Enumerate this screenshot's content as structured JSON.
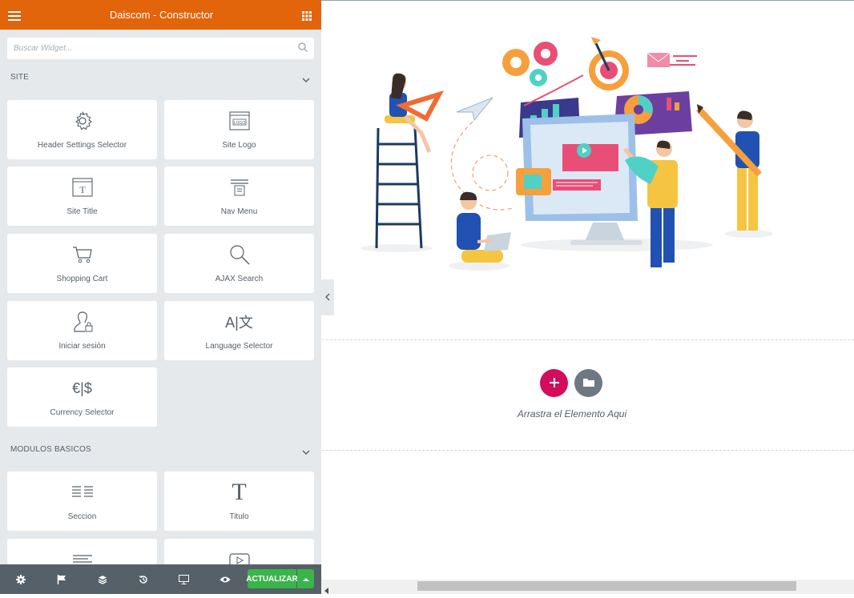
{
  "header": {
    "title": "Daiscom - Constructor"
  },
  "search": {
    "placeholder": "Buscar Widget..."
  },
  "sections": [
    {
      "label": "SITE"
    },
    {
      "label": "MODULOS BASICOS"
    }
  ],
  "site_widgets": [
    {
      "label": "Header Settings Selector",
      "icon": "gear-icon"
    },
    {
      "label": "Site Logo",
      "icon": "logo-icon"
    },
    {
      "label": "Site Title",
      "icon": "title-icon"
    },
    {
      "label": "Nav Menu",
      "icon": "nav-menu-icon"
    },
    {
      "label": "Shopping Cart",
      "icon": "cart-icon"
    },
    {
      "label": "AJAX Search",
      "icon": "search-icon"
    },
    {
      "label": "Iniciar sesión",
      "icon": "login-icon"
    },
    {
      "label": "Language Selector",
      "icon": "language-icon"
    },
    {
      "label": "Currency Selector",
      "icon": "currency-icon"
    }
  ],
  "basic_widgets": [
    {
      "label": "Seccion",
      "icon": "section-icon"
    },
    {
      "label": "Titulo",
      "icon": "heading-icon"
    },
    {
      "label": "",
      "icon": "text-editor-icon"
    },
    {
      "label": "",
      "icon": "video-icon"
    }
  ],
  "icon_text": {
    "logo": "LOGO",
    "title": "T",
    "language": "A|文",
    "currency": "€|$",
    "heading": "T"
  },
  "footer": {
    "icons": [
      "settings-icon",
      "flag-icon",
      "layers-icon",
      "history-icon",
      "responsive-icon",
      "preview-icon"
    ],
    "update_label": "ACTUALIZAR"
  },
  "canvas": {
    "drop_text": "Arrastra el Elemento Aqui"
  },
  "colors": {
    "accent": "#e2640b",
    "add": "#d30c5c",
    "update": "#39b54a"
  }
}
